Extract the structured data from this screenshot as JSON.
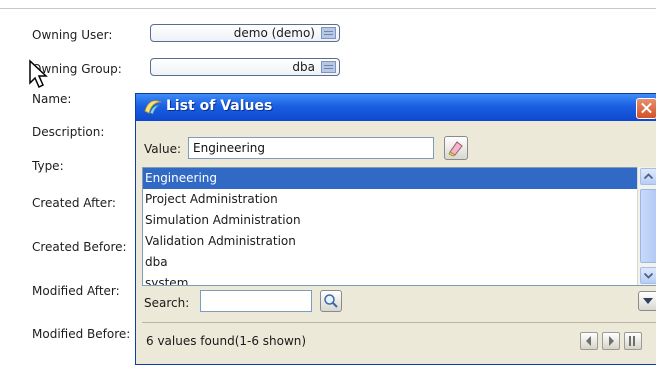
{
  "form": {
    "owning_user_label": "Owning User:",
    "owning_user_value": "demo (demo)",
    "owning_group_label": "Owning Group:",
    "owning_group_value": "dba",
    "name_label": "Name:",
    "description_label": "Description:",
    "type_label": "Type:",
    "created_after_label": "Created After:",
    "created_before_label": "Created Before:",
    "modified_after_label": "Modified After:",
    "modified_before_label": "Modified Before:"
  },
  "dialog": {
    "title": "List of Values",
    "value_label": "Value:",
    "value_input": "Engineering",
    "items": [
      "Engineering",
      "Project Administration",
      "Simulation Administration",
      "Validation Administration",
      "dba",
      "system"
    ],
    "selected_index": 0,
    "search_label": "Search:",
    "search_value": "",
    "status_text": "6 values found(1-6 shown)"
  },
  "colors": {
    "titlebar": "#1a5fe3",
    "selection": "#316ac5",
    "dialog_bg": "#ece9d8",
    "close": "#d4502a"
  },
  "icons": {
    "title": "app-icon",
    "close": "close-icon",
    "value_action": "eraser-icon",
    "search": "magnifier-icon",
    "menu": "dropdown-arrow-icon",
    "lov": "list-icon",
    "prev": "arrow-left-icon",
    "next": "arrow-right-icon",
    "last": "arrow-last-icon"
  }
}
